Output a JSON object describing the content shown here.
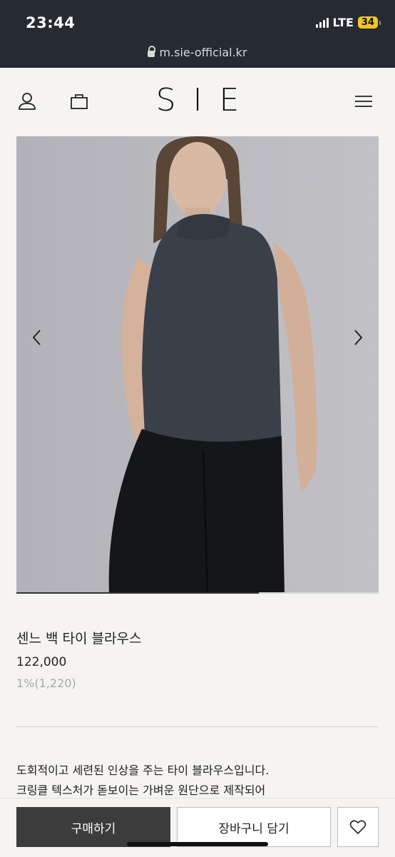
{
  "status_bar": {
    "time": "23:44",
    "network": "LTE",
    "battery": "34"
  },
  "browser": {
    "url": "m.sie-official.kr"
  },
  "header": {
    "logo": "SIE",
    "icons": [
      "user-icon",
      "bag-icon",
      "menu-icon"
    ]
  },
  "gallery": {
    "prev_icon": "chevron-left-icon",
    "next_icon": "chevron-right-icon",
    "progress": 0.67
  },
  "product": {
    "name": "센느 백 타이 블라우스",
    "price": "122,000",
    "points": "1%(1,220)",
    "description_lines": [
      "도회적이고 세련된 인상을 주는 타이 블라우스입니다.",
      "크링클 텍스처가 돋보이는 가벼운 원단으로 제작되어"
    ]
  },
  "actions": {
    "buy_label": "구매하기",
    "cart_label": "장바구니 담기",
    "wishlist_icon": "heart-icon"
  },
  "colors": {
    "top_bar": "#262a31",
    "background": "#f5f4f0",
    "buy_button": "#3c3c3c",
    "battery": "#f3c623"
  }
}
